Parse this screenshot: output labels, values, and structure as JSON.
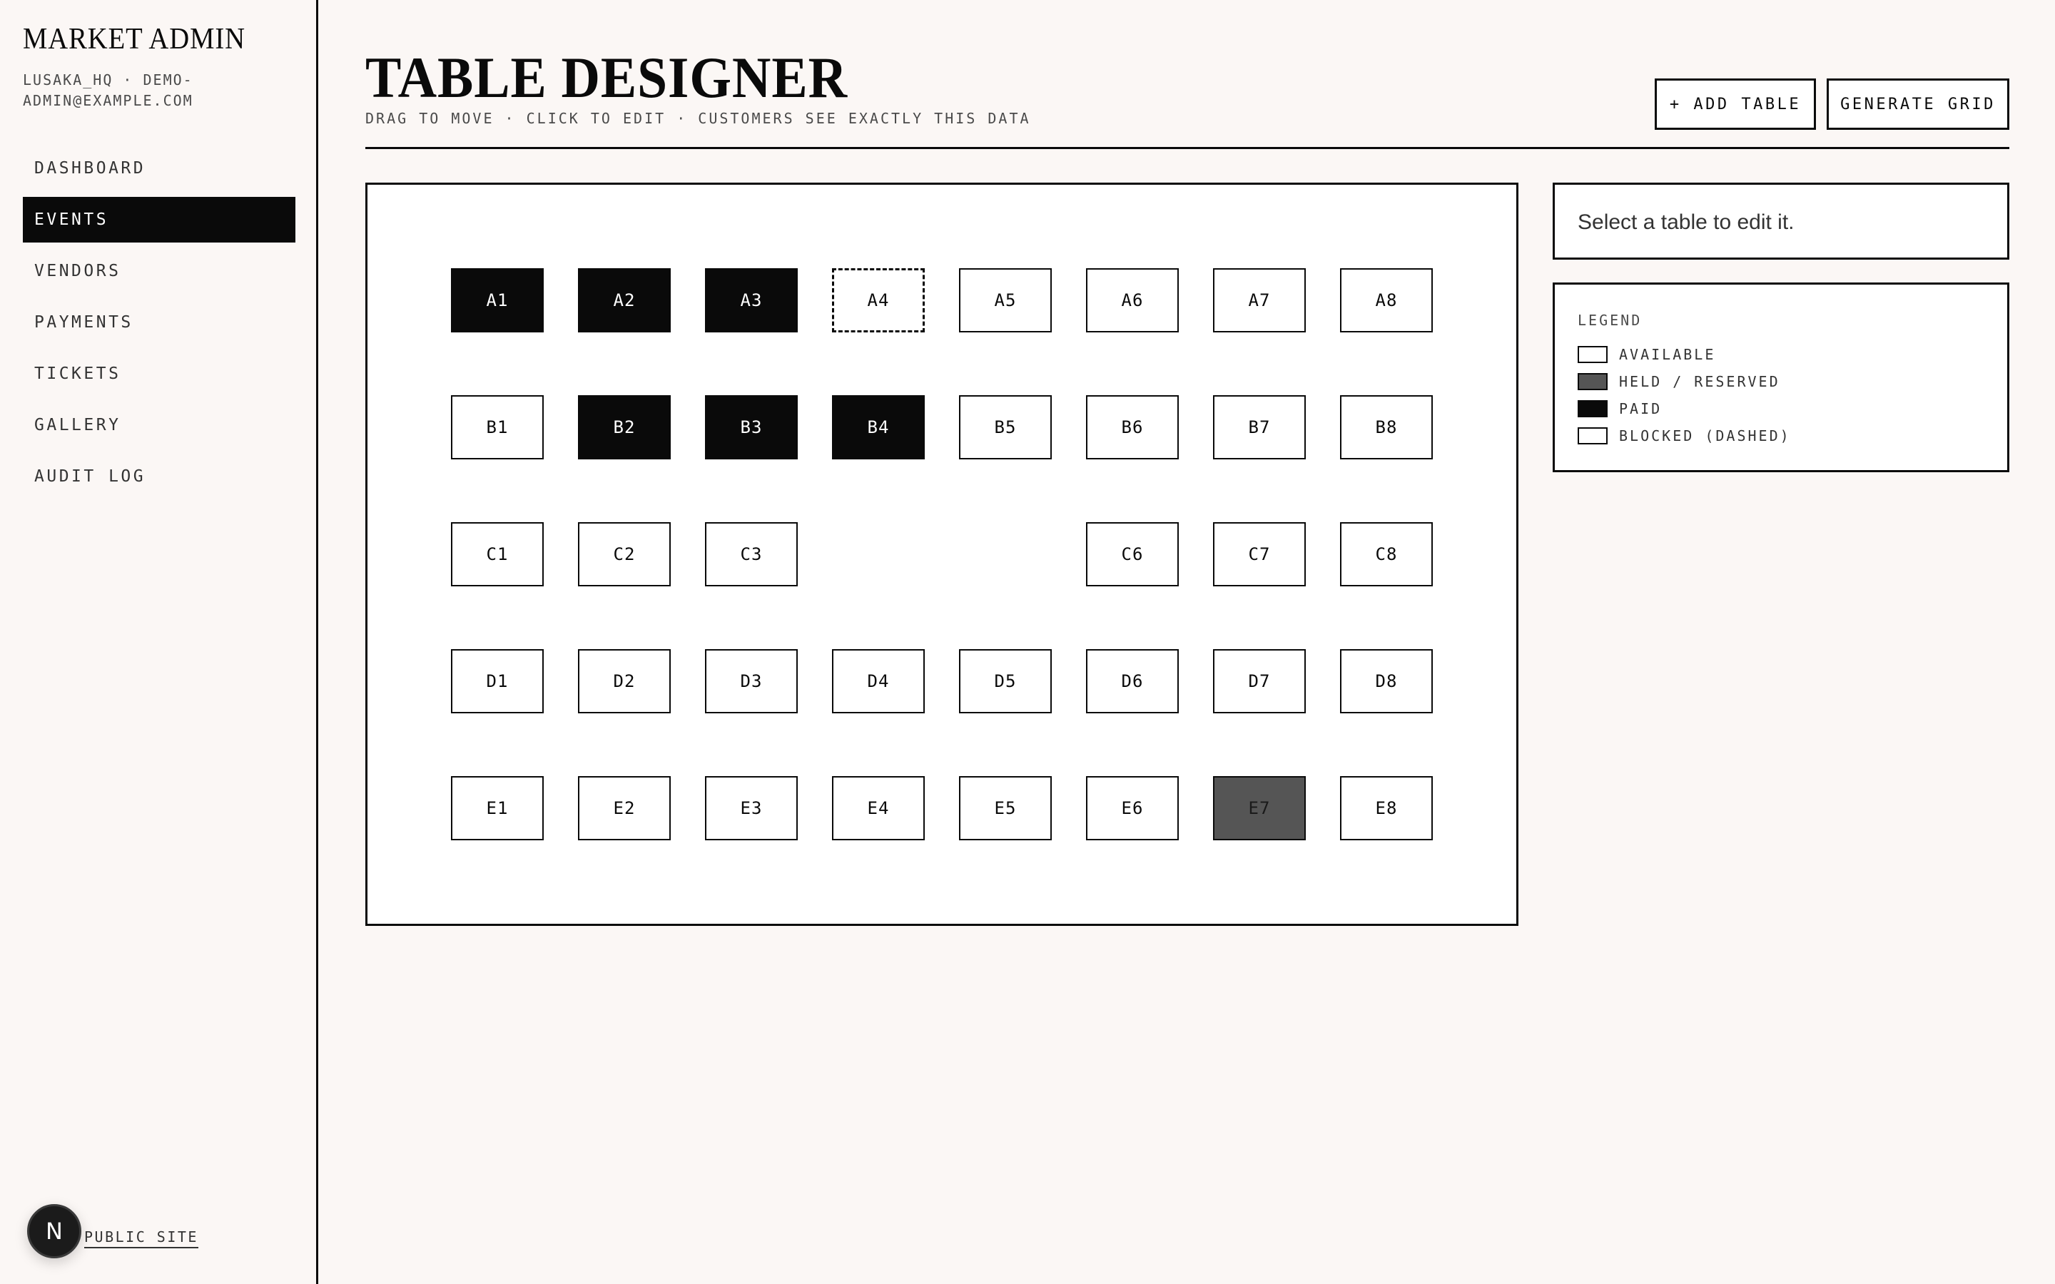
{
  "sidebar": {
    "brand": "MARKET ADMIN",
    "org": "LUSAKA_HQ · DEMO-ADMIN@EXAMPLE.COM",
    "nav": [
      {
        "label": "DASHBOARD",
        "active": false
      },
      {
        "label": "EVENTS",
        "active": true
      },
      {
        "label": "VENDORS",
        "active": false
      },
      {
        "label": "PAYMENTS",
        "active": false
      },
      {
        "label": "TICKETS",
        "active": false
      },
      {
        "label": "GALLERY",
        "active": false
      },
      {
        "label": "AUDIT LOG",
        "active": false
      }
    ],
    "avatar_initial": "N",
    "public_site_label": "PUBLIC SITE"
  },
  "header": {
    "title": "TABLE DESIGNER",
    "subtitle": "DRAG TO MOVE · CLICK TO EDIT · CUSTOMERS SEE EXACTLY THIS DATA",
    "add_table_label": "+ ADD TABLE",
    "generate_grid_label": "GENERATE GRID"
  },
  "floor": {
    "rows": [
      {
        "tables": [
          {
            "label": "A1",
            "status": "paid"
          },
          {
            "label": "A2",
            "status": "paid"
          },
          {
            "label": "A3",
            "status": "paid"
          },
          {
            "label": "A4",
            "status": "blocked"
          },
          {
            "label": "A5",
            "status": "available"
          },
          {
            "label": "A6",
            "status": "available"
          },
          {
            "label": "A7",
            "status": "available"
          },
          {
            "label": "A8",
            "status": "available"
          }
        ]
      },
      {
        "tables": [
          {
            "label": "B1",
            "status": "available"
          },
          {
            "label": "B2",
            "status": "paid"
          },
          {
            "label": "B3",
            "status": "paid"
          },
          {
            "label": "B4",
            "status": "paid"
          },
          {
            "label": "B5",
            "status": "available"
          },
          {
            "label": "B6",
            "status": "available"
          },
          {
            "label": "B7",
            "status": "available"
          },
          {
            "label": "B8",
            "status": "available"
          }
        ]
      },
      {
        "tables": [
          {
            "label": "C1",
            "status": "available"
          },
          {
            "label": "C2",
            "status": "available"
          },
          {
            "label": "C3",
            "status": "available"
          },
          null,
          null,
          {
            "label": "C6",
            "status": "available"
          },
          {
            "label": "C7",
            "status": "available"
          },
          {
            "label": "C8",
            "status": "available"
          }
        ]
      },
      {
        "tables": [
          {
            "label": "D1",
            "status": "available"
          },
          {
            "label": "D2",
            "status": "available"
          },
          {
            "label": "D3",
            "status": "available"
          },
          {
            "label": "D4",
            "status": "available"
          },
          {
            "label": "D5",
            "status": "available"
          },
          {
            "label": "D6",
            "status": "available"
          },
          {
            "label": "D7",
            "status": "available"
          },
          {
            "label": "D8",
            "status": "available"
          }
        ]
      },
      {
        "tables": [
          {
            "label": "E1",
            "status": "available"
          },
          {
            "label": "E2",
            "status": "available"
          },
          {
            "label": "E3",
            "status": "available"
          },
          {
            "label": "E4",
            "status": "available"
          },
          {
            "label": "E5",
            "status": "available"
          },
          {
            "label": "E6",
            "status": "available"
          },
          {
            "label": "E7",
            "status": "held"
          },
          {
            "label": "E8",
            "status": "available"
          }
        ]
      }
    ]
  },
  "edit_panel": {
    "hint": "Select a table to edit it."
  },
  "legend": {
    "title": "LEGEND",
    "items": [
      {
        "label": "AVAILABLE",
        "status": "available"
      },
      {
        "label": "HELD / RESERVED",
        "status": "held"
      },
      {
        "label": "PAID",
        "status": "paid"
      },
      {
        "label": "BLOCKED (DASHED)",
        "status": "blocked"
      }
    ]
  },
  "colors": {
    "ink": "#0a0a0a",
    "background": "#fbf7f5",
    "held": "#555555"
  }
}
